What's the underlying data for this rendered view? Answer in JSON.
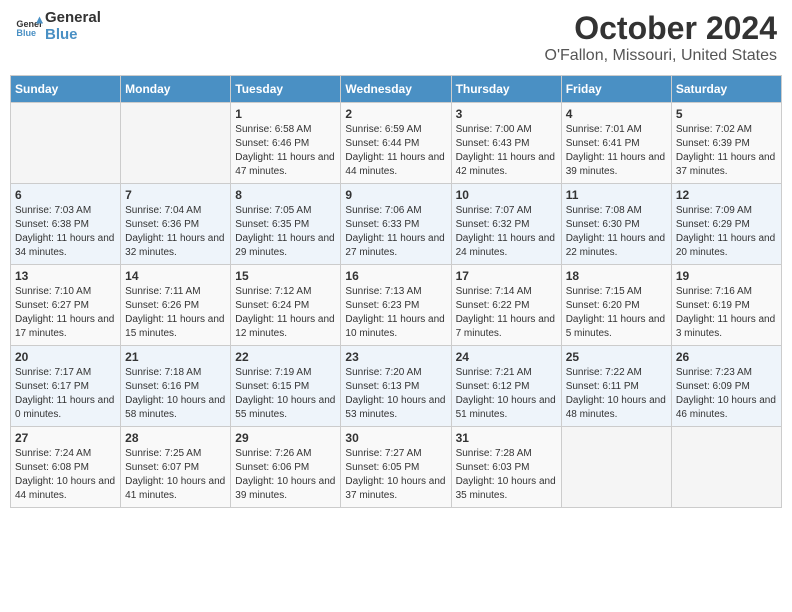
{
  "header": {
    "logo_line1": "General",
    "logo_line2": "Blue",
    "title": "October 2024",
    "subtitle": "O'Fallon, Missouri, United States"
  },
  "weekdays": [
    "Sunday",
    "Monday",
    "Tuesday",
    "Wednesday",
    "Thursday",
    "Friday",
    "Saturday"
  ],
  "rows": [
    [
      null,
      null,
      {
        "n": 1,
        "rise": "6:58 AM",
        "set": "6:46 PM",
        "hours": "11",
        "mins": "47"
      },
      {
        "n": 2,
        "rise": "6:59 AM",
        "set": "6:44 PM",
        "hours": "11",
        "mins": "44"
      },
      {
        "n": 3,
        "rise": "7:00 AM",
        "set": "6:43 PM",
        "hours": "11",
        "mins": "42"
      },
      {
        "n": 4,
        "rise": "7:01 AM",
        "set": "6:41 PM",
        "hours": "11",
        "mins": "39"
      },
      {
        "n": 5,
        "rise": "7:02 AM",
        "set": "6:39 PM",
        "hours": "11",
        "mins": "37"
      }
    ],
    [
      {
        "n": 6,
        "rise": "7:03 AM",
        "set": "6:38 PM",
        "hours": "11",
        "mins": "34"
      },
      {
        "n": 7,
        "rise": "7:04 AM",
        "set": "6:36 PM",
        "hours": "11",
        "mins": "32"
      },
      {
        "n": 8,
        "rise": "7:05 AM",
        "set": "6:35 PM",
        "hours": "11",
        "mins": "29"
      },
      {
        "n": 9,
        "rise": "7:06 AM",
        "set": "6:33 PM",
        "hours": "11",
        "mins": "27"
      },
      {
        "n": 10,
        "rise": "7:07 AM",
        "set": "6:32 PM",
        "hours": "11",
        "mins": "24"
      },
      {
        "n": 11,
        "rise": "7:08 AM",
        "set": "6:30 PM",
        "hours": "11",
        "mins": "22"
      },
      {
        "n": 12,
        "rise": "7:09 AM",
        "set": "6:29 PM",
        "hours": "11",
        "mins": "20"
      }
    ],
    [
      {
        "n": 13,
        "rise": "7:10 AM",
        "set": "6:27 PM",
        "hours": "11",
        "mins": "17"
      },
      {
        "n": 14,
        "rise": "7:11 AM",
        "set": "6:26 PM",
        "hours": "11",
        "mins": "15"
      },
      {
        "n": 15,
        "rise": "7:12 AM",
        "set": "6:24 PM",
        "hours": "11",
        "mins": "12"
      },
      {
        "n": 16,
        "rise": "7:13 AM",
        "set": "6:23 PM",
        "hours": "11",
        "mins": "10"
      },
      {
        "n": 17,
        "rise": "7:14 AM",
        "set": "6:22 PM",
        "hours": "11",
        "mins": "7"
      },
      {
        "n": 18,
        "rise": "7:15 AM",
        "set": "6:20 PM",
        "hours": "11",
        "mins": "5"
      },
      {
        "n": 19,
        "rise": "7:16 AM",
        "set": "6:19 PM",
        "hours": "11",
        "mins": "3"
      }
    ],
    [
      {
        "n": 20,
        "rise": "7:17 AM",
        "set": "6:17 PM",
        "hours": "11",
        "mins": "0"
      },
      {
        "n": 21,
        "rise": "7:18 AM",
        "set": "6:16 PM",
        "hours": "10",
        "mins": "58"
      },
      {
        "n": 22,
        "rise": "7:19 AM",
        "set": "6:15 PM",
        "hours": "10",
        "mins": "55"
      },
      {
        "n": 23,
        "rise": "7:20 AM",
        "set": "6:13 PM",
        "hours": "10",
        "mins": "53"
      },
      {
        "n": 24,
        "rise": "7:21 AM",
        "set": "6:12 PM",
        "hours": "10",
        "mins": "51"
      },
      {
        "n": 25,
        "rise": "7:22 AM",
        "set": "6:11 PM",
        "hours": "10",
        "mins": "48"
      },
      {
        "n": 26,
        "rise": "7:23 AM",
        "set": "6:09 PM",
        "hours": "10",
        "mins": "46"
      }
    ],
    [
      {
        "n": 27,
        "rise": "7:24 AM",
        "set": "6:08 PM",
        "hours": "10",
        "mins": "44"
      },
      {
        "n": 28,
        "rise": "7:25 AM",
        "set": "6:07 PM",
        "hours": "10",
        "mins": "41"
      },
      {
        "n": 29,
        "rise": "7:26 AM",
        "set": "6:06 PM",
        "hours": "10",
        "mins": "39"
      },
      {
        "n": 30,
        "rise": "7:27 AM",
        "set": "6:05 PM",
        "hours": "10",
        "mins": "37"
      },
      {
        "n": 31,
        "rise": "7:28 AM",
        "set": "6:03 PM",
        "hours": "10",
        "mins": "35"
      },
      null,
      null
    ]
  ],
  "labels": {
    "sunrise": "Sunrise:",
    "sunset": "Sunset:",
    "daylight": "Daylight:"
  }
}
